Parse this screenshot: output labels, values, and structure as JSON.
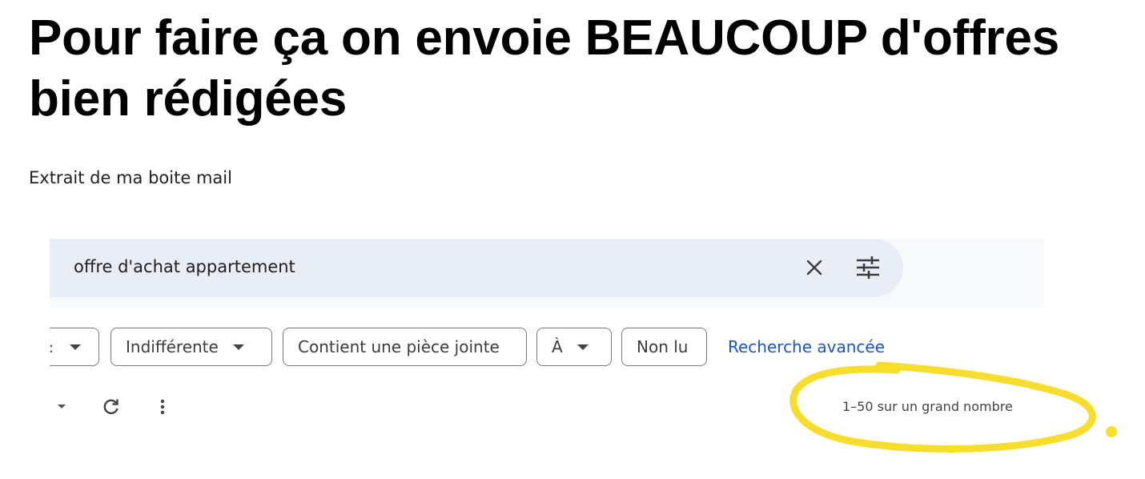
{
  "heading": "Pour faire ça on envoie BEAUCOUP d'offres bien rédigées",
  "caption": "Extrait de ma boite mail",
  "mail": {
    "search": {
      "query": "offre d'achat appartement",
      "clear_icon": "close-icon",
      "options_icon": "tune-icon"
    },
    "filters": {
      "cut_chip_text": ":",
      "chips": [
        {
          "label": "Indifférente",
          "has_caret": true
        },
        {
          "label": "Contient une pièce jointe",
          "has_caret": false
        },
        {
          "label": "À",
          "has_caret": true
        },
        {
          "label": "Non lu",
          "has_caret": false
        }
      ],
      "advanced_link": "Recherche avancée"
    },
    "toolbar": {
      "icons": [
        "caret-down-icon",
        "refresh-icon",
        "more-vert-icon"
      ],
      "pagination": "1–50 sur un grand nombre"
    }
  },
  "colors": {
    "search_bg": "#e9eef6",
    "link": "#1a56c4",
    "highlight": "#f7dd2c"
  }
}
